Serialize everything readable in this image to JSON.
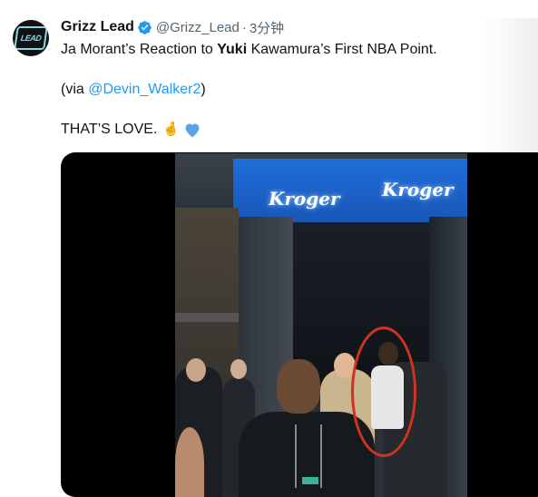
{
  "tweet": {
    "author": {
      "display_name": "Grizz Lead",
      "handle": "@Grizz_Lead",
      "separator": "·",
      "time": "3分钟",
      "verified": true,
      "avatar_icon": "grizz-lead-logo-icon",
      "avatar_text": "LEAD"
    },
    "text": {
      "line1_prefix": "Ja Morant’s Reaction to ",
      "line1_bold": "Yuki",
      "line1_suffix": " Kawamura’s First NBA Point.",
      "line2_prefix": "(via ",
      "line2_link": "@Devin_Walker2",
      "line2_suffix": ")",
      "line3": "THAT’S LOVE.",
      "emoji_hand": "🤞",
      "emoji_heart": "blue-heart-icon"
    },
    "media": {
      "banner_text_1": "Kroger",
      "banner_text_2": "Kroger"
    }
  },
  "colors": {
    "link": "#1d9bf0",
    "verified": "#1d9bf0",
    "secondary_text": "#536471",
    "circle_annotation": "#d2331f"
  }
}
